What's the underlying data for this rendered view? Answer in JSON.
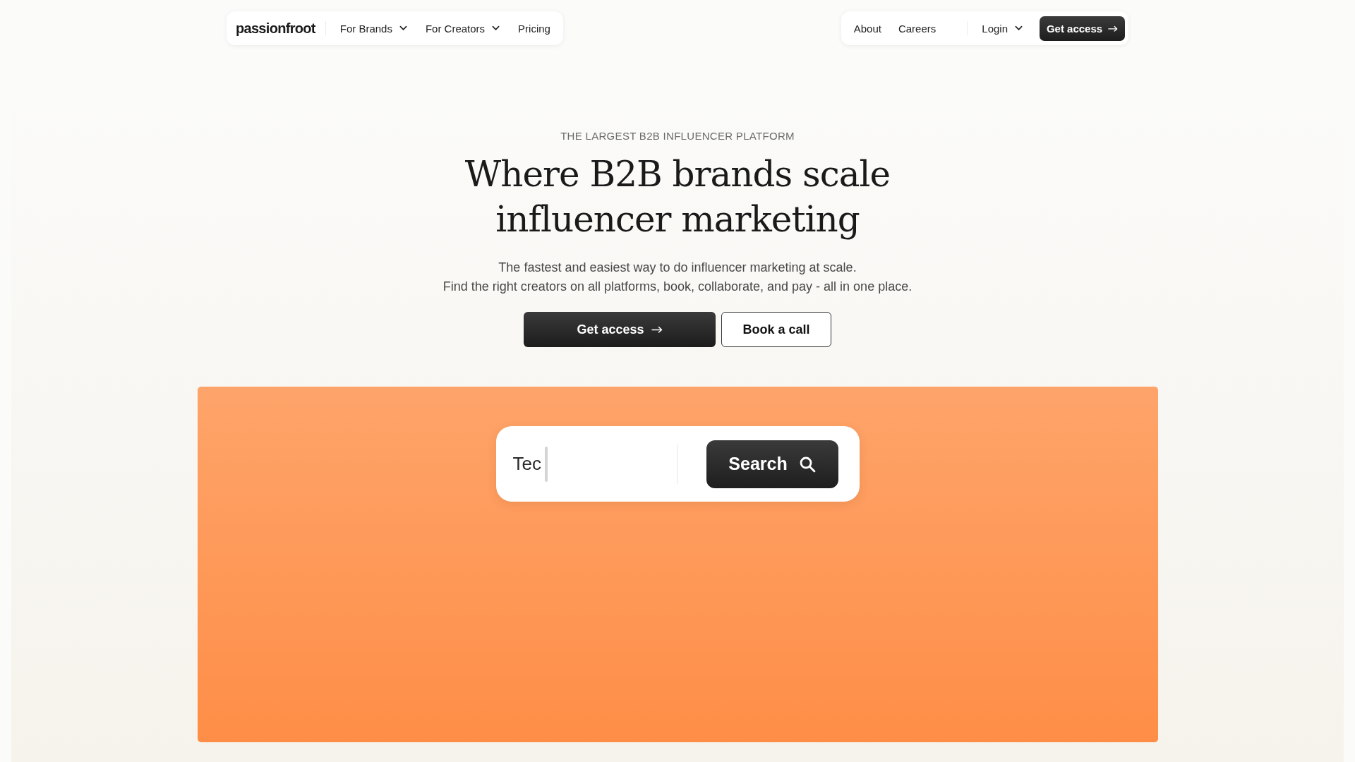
{
  "nav": {
    "logo": "passionfroot",
    "left_links": [
      {
        "label": "For Brands",
        "dropdown": true
      },
      {
        "label": "For Creators",
        "dropdown": true
      },
      {
        "label": "Pricing",
        "dropdown": false
      }
    ],
    "right_links": [
      {
        "label": "About",
        "dropdown": false
      },
      {
        "label": "Careers",
        "dropdown": false
      }
    ],
    "login": {
      "label": "Login",
      "dropdown": true
    },
    "cta": {
      "label": "Get access"
    }
  },
  "hero": {
    "eyebrow": "THE LARGEST B2B INFLUENCER PLATFORM",
    "headline": "Where B2B brands scale influencer marketing",
    "subtitle_lines": [
      "The fastest and easiest way to do influencer marketing at scale.",
      "Find the right creators on all platforms, book, collaborate, and pay - all in one place."
    ],
    "buttons": [
      {
        "label": "Get access",
        "kind": "primary"
      },
      {
        "label": "Book a call",
        "kind": "secondary"
      }
    ]
  },
  "search": {
    "value": "Tec",
    "button": "Search"
  }
}
